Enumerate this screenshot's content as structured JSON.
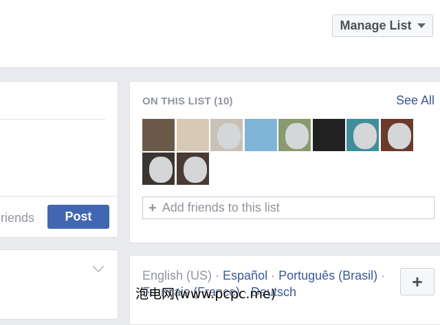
{
  "header": {
    "manage_list_label": "Manage List"
  },
  "composer": {
    "friends_text": "riends",
    "post_label": "Post"
  },
  "members": {
    "heading": "ON THIS LIST (10)",
    "see_all": "See All",
    "add_placeholder": "Add friends to this list",
    "thumbs": [
      {
        "name": "member-thumb-1",
        "bg": "#6b5a4a"
      },
      {
        "name": "member-thumb-2",
        "bg": "#d8c8b6"
      },
      {
        "name": "member-thumb-3",
        "bg": "#c9c0b8"
      },
      {
        "name": "member-thumb-4",
        "bg": "#7fb3d8"
      },
      {
        "name": "member-thumb-5",
        "bg": "#8a9a70"
      },
      {
        "name": "member-thumb-6",
        "bg": "#222222"
      },
      {
        "name": "member-thumb-7",
        "bg": "#3f8f9a"
      },
      {
        "name": "member-thumb-8",
        "bg": "#6a3a2a"
      },
      {
        "name": "member-thumb-9",
        "bg": "#3a3530"
      },
      {
        "name": "member-thumb-10",
        "bg": "#4a3a34"
      }
    ]
  },
  "languages": {
    "current": "English (US)",
    "sep": " · ",
    "links": [
      "Español",
      "Português (Brasil)"
    ],
    "line2_links": [
      "Français (France)",
      "Deutsch"
    ]
  },
  "watermark": "泡电网(www.pcpc.me)"
}
